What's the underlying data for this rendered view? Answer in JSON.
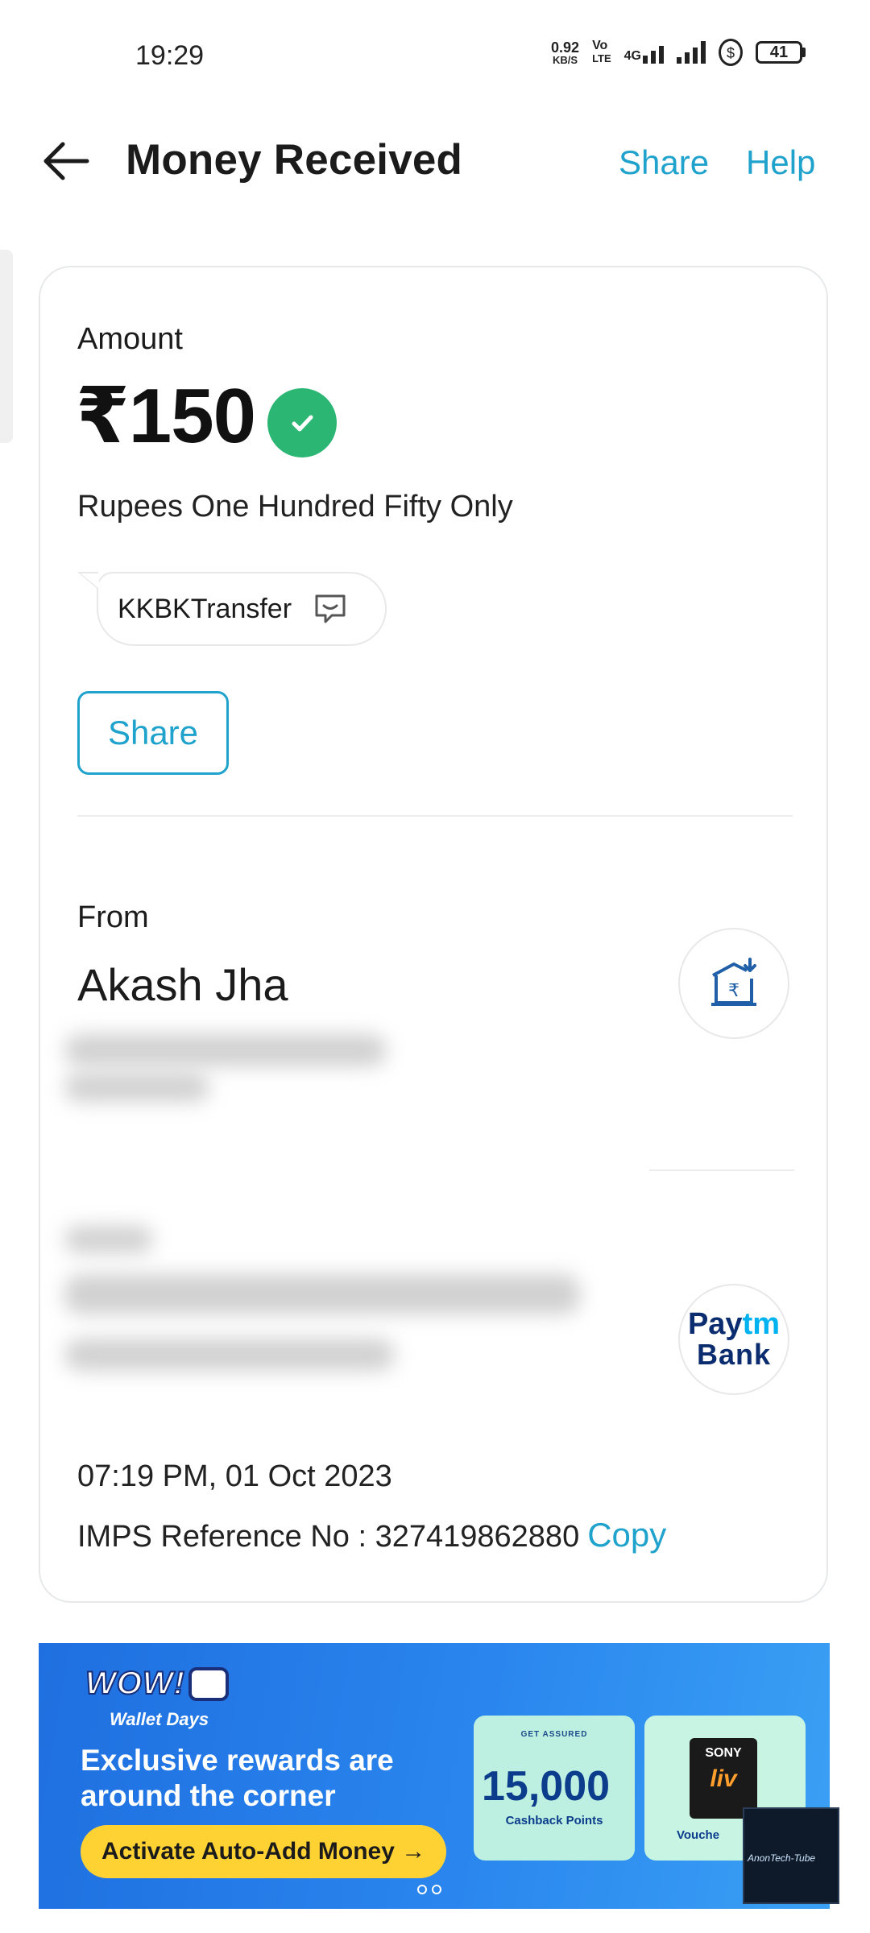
{
  "status_bar": {
    "time": "19:29",
    "net_speed_value": "0.92",
    "net_speed_unit": "KB/S",
    "volte_top": "Vo",
    "volte_bottom": "LTE",
    "network": "4G",
    "battery": "41"
  },
  "header": {
    "title": "Money Received",
    "share_label": "Share",
    "help_label": "Help"
  },
  "transaction": {
    "amount_label": "Amount",
    "amount": "₹150",
    "amount_words": "Rupees One Hundred Fifty Only",
    "note": "KKBKTransfer",
    "share_button": "Share",
    "from_label": "From",
    "from_name": "Akash Jha",
    "datetime": "07:19 PM, 01 Oct 2023",
    "reference_label": "IMPS Reference No : ",
    "reference_no": "327419862880",
    "copy_label": "Copy",
    "bank_logo_line1": "Pay",
    "bank_logo_line1_accent": "tm",
    "bank_logo_line2": "Bank"
  },
  "banner": {
    "wow": "WOW!",
    "wallet_days": "Wallet Days",
    "headline": "Exclusive rewards are around the corner",
    "cta": "Activate Auto-Add Money →",
    "offer_tag": "GET ASSURED",
    "offer_points": "15,000",
    "offer_sub": "Cashback Points",
    "sony_brand": "SONY",
    "sony_product": "liv",
    "voucher": "Vouche"
  },
  "watermark": "AnonTech-Tube",
  "colors": {
    "accent": "#1fa3cc",
    "success": "#2bb673",
    "banner_blue": "#2a86ee",
    "cta_yellow": "#ffd234"
  },
  "icons": {
    "back": "arrow-left-icon",
    "check": "check-circle-icon",
    "note": "chat-bubble-icon",
    "bank": "bank-rupee-icon"
  }
}
